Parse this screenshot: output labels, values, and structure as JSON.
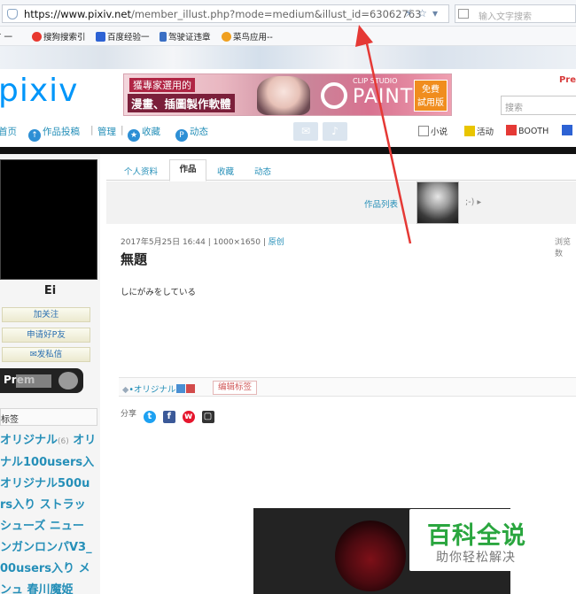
{
  "browser": {
    "url_scheme_host": "https://www.pixiv.net",
    "url_path": "/member_illust.php?mode=medium&illust_id=63062763",
    "search_placeholder": "输入文字搜索",
    "icons": [
      "shield-icon",
      "lightning-icon",
      "star-icon",
      "chevron-down-icon"
    ]
  },
  "bookmarks": [
    {
      "label": "首 一",
      "icon": "bookmark-icon",
      "color": "#c44"
    },
    {
      "label": "搜狗搜索引",
      "icon": "sogou-icon",
      "color": "#e8382f"
    },
    {
      "label": "百度经验一",
      "icon": "baidu-icon",
      "color": "#2d62d4"
    },
    {
      "label": "驾驶证违章",
      "icon": "car-icon",
      "color": "#3a6fc4"
    },
    {
      "label": "菜鸟应用--",
      "icon": "cainiao-icon",
      "color": "#f0a020"
    }
  ],
  "header": {
    "logo": "pixiv",
    "banner": {
      "line1": "獲專家選用的",
      "line2": "漫畫、插圖製作軟體",
      "studio": "CLIP STUDIO",
      "paint": "PAINT",
      "trial": "免費\n試用版"
    },
    "premium_label": "Pre",
    "site_search_placeholder": "搜索"
  },
  "nav": {
    "home": "首页",
    "submit": "作品投稿",
    "manage": "管理",
    "bookmarks": "收藏",
    "feed": "动态",
    "novel": "小说",
    "events": "活动",
    "booth": "BOOTH"
  },
  "sidebar": {
    "username": "Ei",
    "follow": "加关注",
    "friend": "申请好P友",
    "message": "发私信",
    "premium_text": "Prem",
    "tags_title": "标签",
    "tag_lines": [
      {
        "text": "オリジナル",
        "count": "(6)",
        "rest": " オリ"
      },
      {
        "text": "ナル100users入",
        "count": "",
        "rest": ""
      },
      {
        "text": "オリジナル500u",
        "count": "",
        "rest": ""
      },
      {
        "text": "rs入り ストラッ",
        "count": "",
        "rest": ""
      },
      {
        "text": "シューズ ニュー",
        "count": "",
        "rest": ""
      },
      {
        "text": "ンガンロンパV3_",
        "count": "",
        "rest": ""
      },
      {
        "text": "00users入り メ",
        "count": "",
        "rest": ""
      },
      {
        "text": "ンュ 春川魔姫",
        "count": "",
        "rest": ""
      }
    ]
  },
  "main": {
    "tabs": [
      "个人资料",
      "作品",
      "收藏",
      "动态"
    ],
    "works_list": "作品列表",
    "next_label": ";-) ▸",
    "meta_date": "2017年5月25日 16:44",
    "meta_size": "1000×1650",
    "meta_original": "原创",
    "views_label": "浏览数",
    "title": "無題",
    "caption": "しにがみをしている",
    "tag": "•オリジナル",
    "edit_tags": "编辑标签",
    "share_label": "分享",
    "share_icons": [
      "twitter-icon",
      "facebook-icon",
      "weibo-icon",
      "line-icon"
    ]
  },
  "watermark": {
    "title": "百科全说",
    "subtitle": "助你轻松解决"
  },
  "colors": {
    "pixiv_blue": "#0096fa",
    "link_blue": "#258fb8",
    "arrow_red": "#e53935",
    "watermark_green": "#2aa63f"
  }
}
